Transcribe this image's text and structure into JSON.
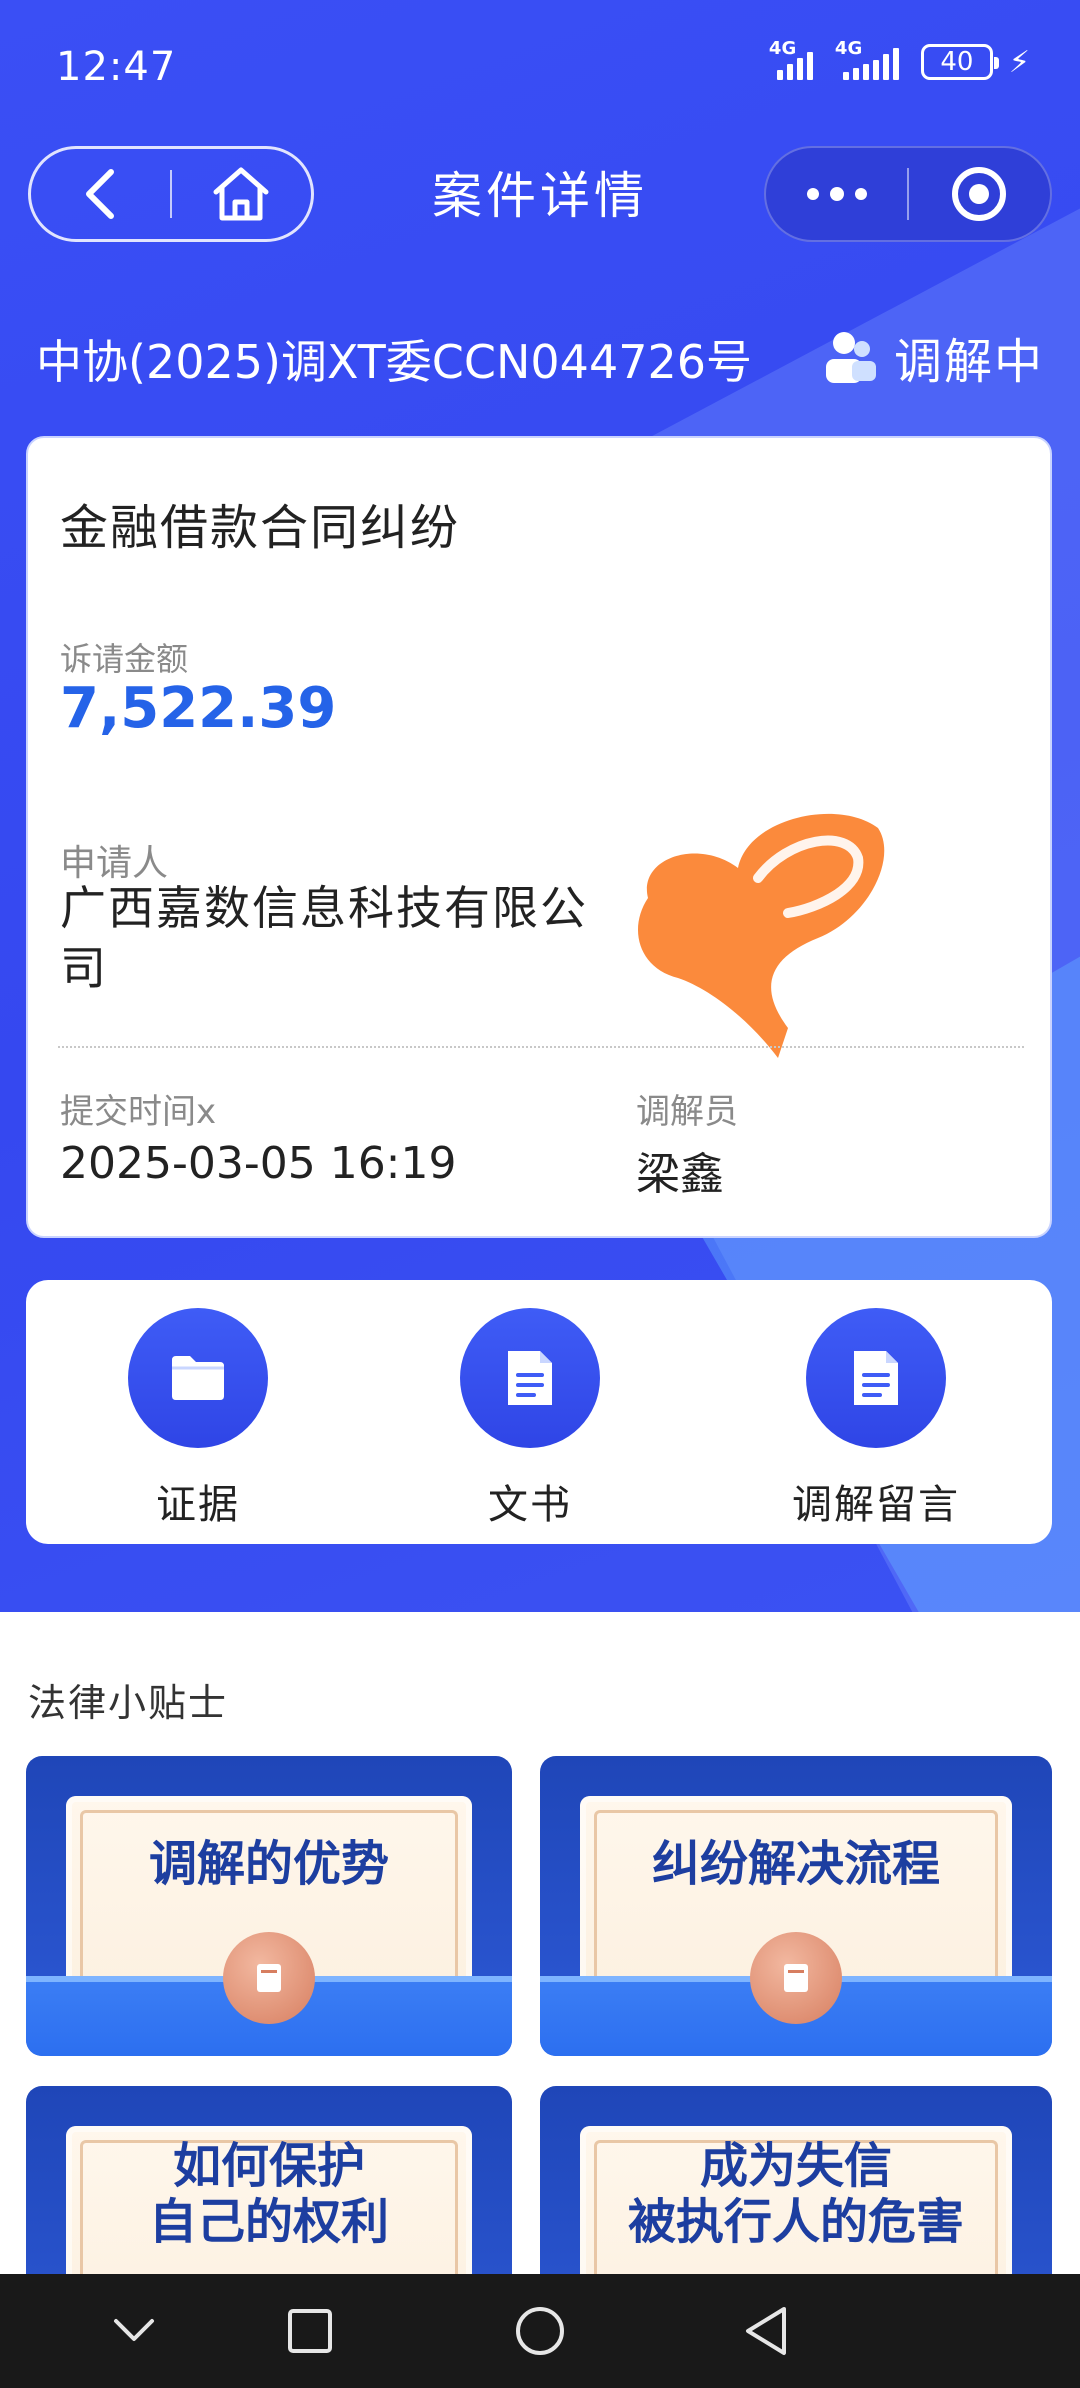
{
  "status_bar": {
    "time": "12:47",
    "network1": "4G",
    "network2": "4G",
    "battery": "40"
  },
  "nav": {
    "title": "案件详情",
    "back_icon": "chevron-left-icon",
    "home_icon": "home-icon",
    "more_icon": "more-dots-icon",
    "close_icon": "target-icon"
  },
  "case": {
    "number": "中协(2025)调XT委CCN044726号",
    "status": "调解中",
    "type": "金融借款合同纠纷",
    "amount_label": "诉请金额",
    "amount": "7,522.39",
    "applicant_label": "申请人",
    "applicant": "广西嘉数信息科技有限公司",
    "submit_time_label": "提交时间x",
    "submit_time": "2025-03-05 16:19",
    "mediator_label": "调解员",
    "mediator": "梁鑫"
  },
  "actions": [
    {
      "label": "证据",
      "icon": "folder-icon"
    },
    {
      "label": "文书",
      "icon": "document-icon"
    },
    {
      "label": "调解留言",
      "icon": "document-icon"
    }
  ],
  "tips": {
    "title": "法律小贴士",
    "items": [
      {
        "line1": "调解的优势",
        "line2": ""
      },
      {
        "line1": "纠纷解决流程",
        "line2": ""
      },
      {
        "line1": "如何保护",
        "line2": "自己的权利"
      },
      {
        "line1": "成为失信",
        "line2": "被执行人的危害"
      }
    ]
  },
  "colors": {
    "primary": "#3a4ff5",
    "amount": "#2563e8",
    "scribble": "#fb8a3c"
  }
}
